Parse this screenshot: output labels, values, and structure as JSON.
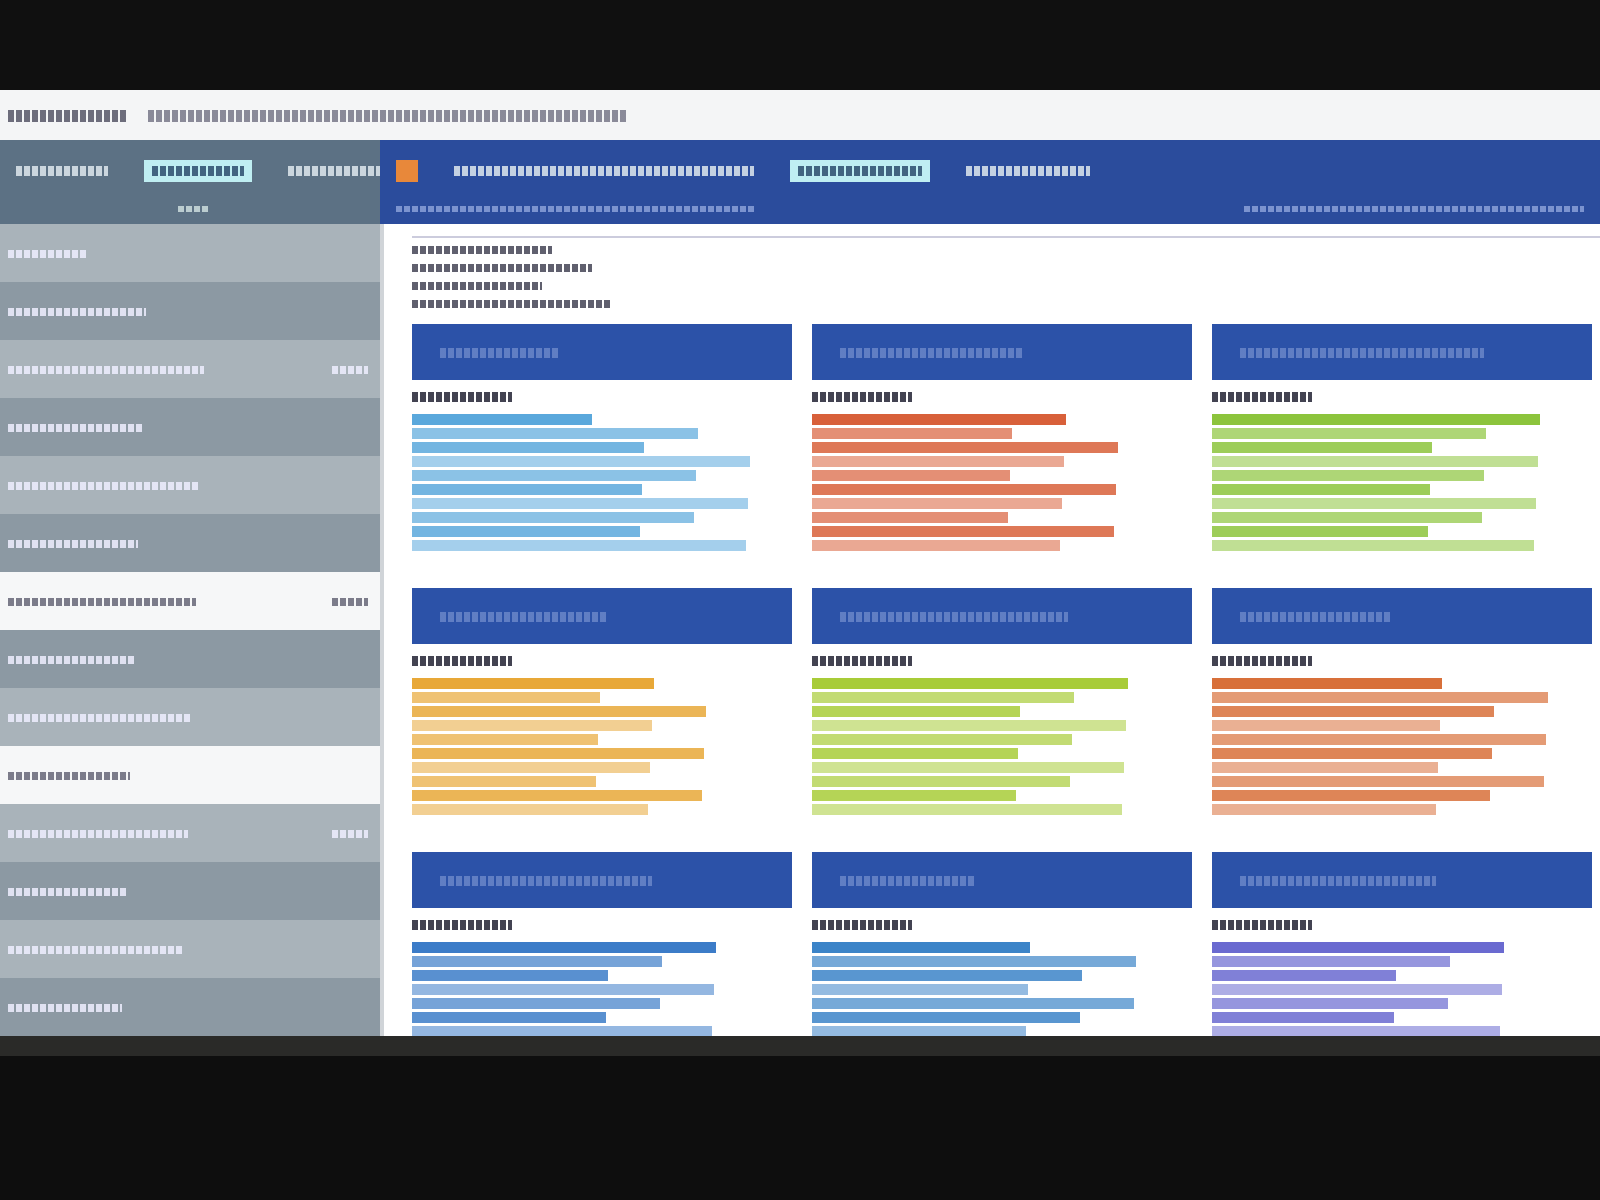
{
  "nav": {
    "items": [
      {
        "selected": false
      },
      {
        "selected": true
      },
      {
        "selected": false
      },
      {
        "selected": false
      },
      {
        "selected": true
      },
      {
        "selected": false
      }
    ]
  },
  "sidebar": {
    "items": [
      {
        "selected": false
      },
      {
        "selected": false
      },
      {
        "selected": false
      },
      {
        "selected": false
      },
      {
        "selected": false
      },
      {
        "selected": false
      },
      {
        "selected": true
      },
      {
        "selected": false
      },
      {
        "selected": false
      },
      {
        "selected": true
      },
      {
        "selected": false
      },
      {
        "selected": false
      },
      {
        "selected": false
      },
      {
        "selected": false
      }
    ]
  },
  "cards": [
    {
      "color": "#5aa8dc"
    },
    {
      "color": "#d8603a"
    },
    {
      "color": "#8cc43c"
    },
    {
      "color": "#e8a838"
    },
    {
      "color": "#a8cc38"
    },
    {
      "color": "#d8703a"
    },
    {
      "color": "#3c7cc8"
    },
    {
      "color": "#3c84c8"
    },
    {
      "color": "#6a6ad0"
    }
  ]
}
